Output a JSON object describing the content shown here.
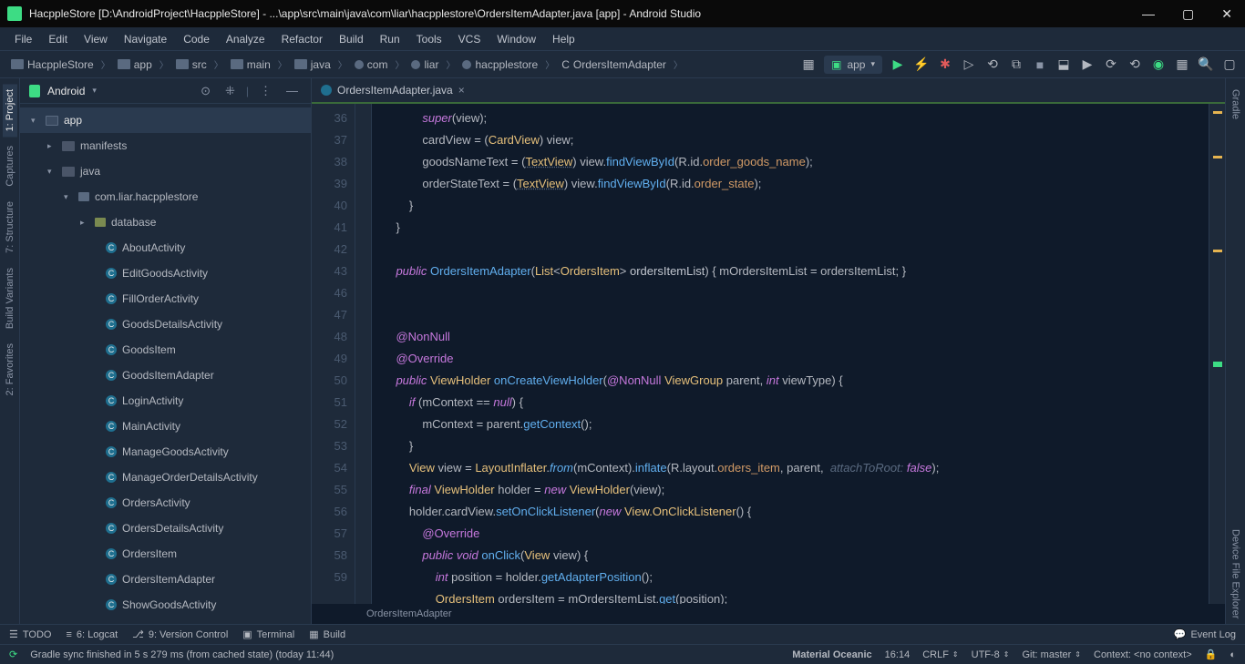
{
  "window": {
    "title": "HacppleStore [D:\\AndroidProject\\HacppleStore] - ...\\app\\src\\main\\java\\com\\liar\\hacpplestore\\OrdersItemAdapter.java [app] - Android Studio"
  },
  "menu": [
    "File",
    "Edit",
    "View",
    "Navigate",
    "Code",
    "Analyze",
    "Refactor",
    "Build",
    "Run",
    "Tools",
    "VCS",
    "Window",
    "Help"
  ],
  "breadcrumbs": [
    "HacppleStore",
    "app",
    "src",
    "main",
    "java",
    "com",
    "liar",
    "hacpplestore",
    "OrdersItemAdapter"
  ],
  "runConfig": "app",
  "projectView": {
    "mode": "Android",
    "root": "app",
    "manifests": "manifests",
    "java": "java",
    "package": "com.liar.hacpplestore",
    "database": "database",
    "classes": [
      "AboutActivity",
      "EditGoodsActivity",
      "FillOrderActivity",
      "GoodsDetailsActivity",
      "GoodsItem",
      "GoodsItemAdapter",
      "LoginActivity",
      "MainActivity",
      "ManageGoodsActivity",
      "ManageOrderDetailsActivity",
      "OrdersActivity",
      "OrdersDetailsActivity",
      "OrdersItem",
      "OrdersItemAdapter",
      "ShowGoodsActivity"
    ]
  },
  "leftTabs": [
    "1: Project",
    "Captures",
    "7: Structure",
    "Build Variants",
    "2: Favorites"
  ],
  "rightTabs": [
    "Gradle",
    "Device File Explorer"
  ],
  "editor": {
    "tabName": "OrdersItemAdapter.java",
    "crumb": "OrdersItemAdapter",
    "startLine": 36,
    "lines": [
      36,
      37,
      38,
      39,
      40,
      41,
      42,
      43,
      "",
      46,
      47,
      48,
      49,
      50,
      51,
      52,
      53,
      54,
      55,
      56,
      57,
      58,
      59
    ],
    "caretPos": "16:14"
  },
  "bottomTabs": {
    "todo": "TODO",
    "logcat": "6: Logcat",
    "vcs": "9: Version Control",
    "terminal": "Terminal",
    "build": "Build",
    "eventLog": "Event Log"
  },
  "status": {
    "message": "Gradle sync finished in 5 s 279 ms (from cached state) (today 11:44)",
    "theme": "Material Oceanic",
    "pos": "16:14",
    "lineEnd": "CRLF",
    "encoding": "UTF-8",
    "git": "Git: master",
    "context": "Context: <no context>"
  }
}
